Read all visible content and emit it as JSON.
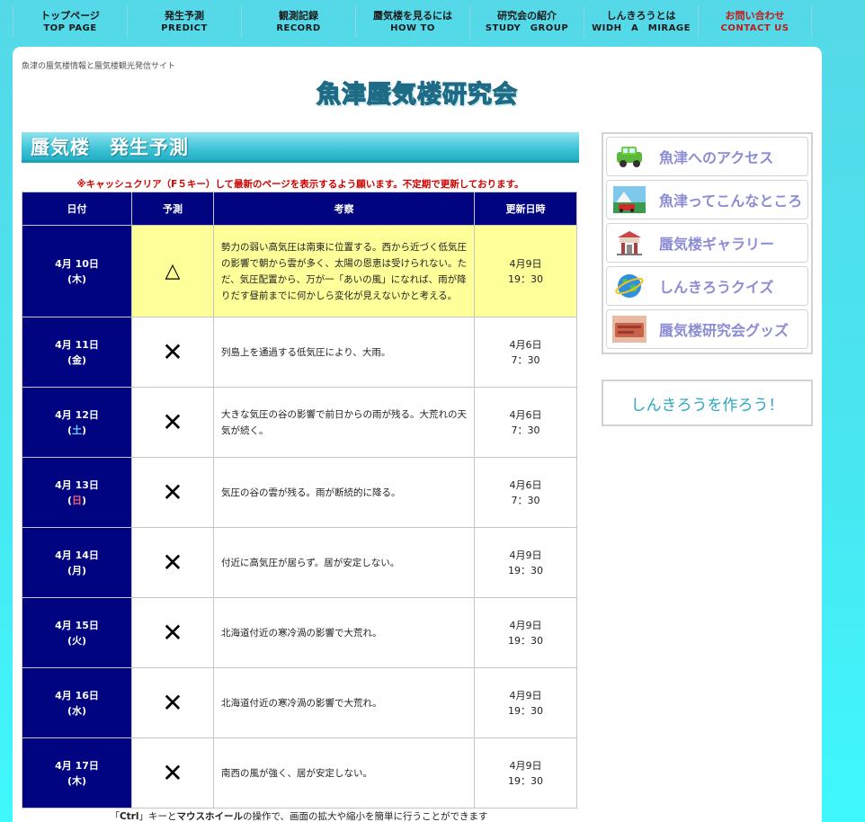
{
  "nav": [
    {
      "ja": "トップページ",
      "en": "TOP PAGE"
    },
    {
      "ja": "発生予測",
      "en": "PREDICT"
    },
    {
      "ja": "観測記録",
      "en": "RECORD"
    },
    {
      "ja": "蜃気楼を見るには",
      "en": "HOW TO"
    },
    {
      "ja": "研究会の紹介",
      "en": "STUDY　GROUP"
    },
    {
      "ja": "しんきろうとは",
      "en": "WIDH　A　MIRAGE"
    },
    {
      "ja": "お問い合わせ",
      "en": "CONTACT US"
    }
  ],
  "header": {
    "tagline": "魚津の蜃気楼情報と蜃気楼観光発信サイト",
    "logo": "魚津蜃気楼研究会"
  },
  "main": {
    "title": "蜃気楼　発生予測",
    "notice": "※キャッシュクリア（F５キー）して最新のページを表示するよう願います。不定期で更新しております。",
    "columns": [
      "日付",
      "予測",
      "考察",
      "更新日時"
    ],
    "rows": [
      {
        "date": "4月 10日",
        "dow": "(木)",
        "mark": "△",
        "note": "勢力の弱い高気圧は南東に位置する。西から近づく低気圧の影響で朝から雲が多く、太陽の恩恵は受けられない。ただ、気圧配置から、万が一「あいの風」になれば、雨が降りだす昼前までに何かしら変化が見えないかと考える。",
        "upd_date": "4月9日",
        "upd_time": "19：30"
      },
      {
        "date": "4月 11日",
        "dow": "(金)",
        "mark": "✕",
        "note": "列島上を通過する低気圧により、大雨。",
        "upd_date": "4月6日",
        "upd_time": "7：30"
      },
      {
        "date": "4月 12日",
        "dow_open": "(",
        "dow_day": "土",
        "dow_close": ")",
        "mark": "✕",
        "note": "大きな気圧の谷の影響で前日からの雨が残る。大荒れの天気が続く。",
        "upd_date": "4月6日",
        "upd_time": "7：30"
      },
      {
        "date": "4月 13日",
        "dow_open": "(",
        "dow_day": "日",
        "dow_close": ")",
        "mark": "✕",
        "note": "気圧の谷の雲が残る。雨が断続的に降る。",
        "upd_date": "4月6日",
        "upd_time": "7：30"
      },
      {
        "date": "4月 14日",
        "dow": "(月)",
        "mark": "✕",
        "note": "付近に高気圧が居らず。居が安定しない。",
        "upd_date": "4月9日",
        "upd_time": "19：30"
      },
      {
        "date": "4月 15日",
        "dow": "(火)",
        "mark": "✕",
        "note": "北海道付近の寒冷渦の影響で大荒れ。",
        "upd_date": "4月9日",
        "upd_time": "19：30"
      },
      {
        "date": "4月 16日",
        "dow": "(水)",
        "mark": "✕",
        "note": "北海道付近の寒冷渦の影響で大荒れ。",
        "upd_date": "4月9日",
        "upd_time": "19：30"
      },
      {
        "date": "4月 17日",
        "dow": "(木)",
        "mark": "✕",
        "note": "南西の風が強く、居が安定しない。",
        "upd_date": "4月9日",
        "upd_time": "19：30"
      }
    ],
    "footnote": {
      "pre": "「",
      "key1": "Ctrl",
      "mid1": "」キーと",
      "key2": "マウスホイール",
      "post": "の操作で、画面の拡大や縮小を簡単に行うことができます"
    }
  },
  "sidebar": {
    "items": [
      {
        "label": "魚津へのアクセス",
        "icon": "car-icon"
      },
      {
        "label": "魚津ってこんなところ",
        "icon": "landscape-icon"
      },
      {
        "label": "蜃気楼ギャラリー",
        "icon": "building-icon"
      },
      {
        "label": "しんきろうクイズ",
        "icon": "globe-icon"
      },
      {
        "label": "蜃気楼研究会グッズ",
        "icon": "goods-icon"
      }
    ],
    "make_button": "しんきろうを作ろう！"
  }
}
